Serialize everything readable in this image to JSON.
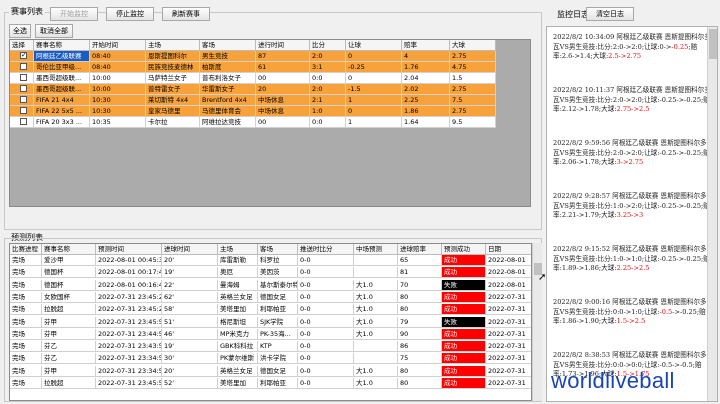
{
  "top_group": {
    "title": "赛事列表"
  },
  "toolbar": {
    "start": "开始监控",
    "stop": "停止监控",
    "refresh": "刷新赛事"
  },
  "select_bar": {
    "select_all": "全选",
    "deselect_all": "取消全部"
  },
  "log_panel": {
    "title": "监控日志",
    "clear": "清空日志"
  },
  "matches": {
    "columns": [
      "选择",
      "赛事名称",
      "开始时间",
      "主场",
      "客场",
      "进行时间",
      "比分",
      "让球",
      "赔率",
      "大球"
    ],
    "rows": [
      {
        "checked": true,
        "style": "orange",
        "sel": true,
        "cells": [
          "阿根廷乙级联赛",
          "08:40",
          "恩斯提图科尔",
          "男生竞技",
          "87",
          "2:0",
          "0",
          "4",
          "2.75"
        ]
      },
      {
        "checked": false,
        "style": "orange",
        "sel": false,
        "cells": [
          "哥伦比亚甲级...",
          "08:40",
          "民族竞技麦德林",
          "柏斯度",
          "61",
          "3:1",
          "-0.25",
          "1.76",
          "4.75"
        ]
      },
      {
        "checked": false,
        "style": "white",
        "sel": false,
        "cells": [
          "墨西哥超级联...",
          "10:00",
          "马萨特兰女子",
          "普布利洛女子",
          "00",
          "0:0",
          "0",
          "2.04",
          "1.5"
        ]
      },
      {
        "checked": false,
        "style": "orange",
        "sel": false,
        "cells": [
          "墨西哥超级联...",
          "10:00",
          "普特雷女子",
          "华雷斯女子",
          "20",
          "2:0",
          "-1.5",
          "2.02",
          "2.75"
        ]
      },
      {
        "checked": false,
        "style": "orange",
        "sel": false,
        "cells": [
          "FIFA 21 4x4",
          "10:30",
          "莱切斯特 4x4",
          "Brentford 4x4",
          "中场休息",
          "2:1",
          "1",
          "2.25",
          "7.5"
        ]
      },
      {
        "checked": false,
        "style": "orange",
        "sel": false,
        "cells": [
          "FIFA 22 5x5 ...",
          "10:30",
          "皇家马德里",
          "马德里体育会",
          "中场休息",
          "1:0",
          "0",
          "1.86",
          "2.75"
        ]
      },
      {
        "checked": false,
        "style": "white",
        "sel": false,
        "cells": [
          "FIFA 20 3x3 ...",
          "10:35",
          "卡尔拉",
          "阿维拉达竞技",
          "00",
          "0:0",
          "1",
          "1.64",
          "9.5"
        ]
      }
    ]
  },
  "pred_group": {
    "title": "预测列表"
  },
  "predictions": {
    "columns": [
      "比赛进程",
      "赛事名称",
      "预测时间",
      "进球时间",
      "主场",
      "客场",
      "推送时比分",
      "中场预测",
      "进球赔率",
      "预测成功",
      "日期"
    ],
    "rows": [
      {
        "c": [
          "完场",
          "爱沙甲",
          "2022-08-01 00:45:31",
          "20'",
          "库雷斯勒",
          "科罗拉",
          "0-0",
          "",
          "65",
          "成功",
          "2022-08-01"
        ],
        "r": "red"
      },
      {
        "c": [
          "完场",
          "德国杯",
          "2022-08-01 00:17:46",
          "19'",
          "奥厄",
          "美因茨",
          "0-0",
          "",
          "81",
          "成功",
          "2022-08-01"
        ],
        "r": "red"
      },
      {
        "c": [
          "完场",
          "德国杯",
          "2022-08-01 00:16:46",
          "22'",
          "曼海姆",
          "基尔斯泰尔特",
          "0-0",
          "大1.0",
          "70",
          "失败",
          "2022-08-01"
        ],
        "r": "black"
      },
      {
        "c": [
          "完场",
          "女欧国杯",
          "2022-07-31 23:45:28",
          "62'",
          "英格兰女足",
          "德国女足",
          "0-0",
          "大1.0",
          "80",
          "成功",
          "2022-07-31"
        ],
        "r": "red"
      },
      {
        "c": [
          "完场",
          "拉脱超",
          "2022-07-31 23:45:28",
          "58'",
          "美塔里加",
          "利耶帕亚",
          "0-0",
          "大1.0",
          "80",
          "成功",
          "2022-07-31"
        ],
        "r": "red"
      },
      {
        "c": [
          "完场",
          "芬甲",
          "2022-07-31 23:45:58",
          "51'",
          "格尼斯坦",
          "SJK学院",
          "0-0",
          "大1.0",
          "79",
          "失败",
          "2022-07-31"
        ],
        "r": "black"
      },
      {
        "c": [
          "完场",
          "芬甲",
          "2022-07-31 23:44:59",
          "46'",
          "MP米克力",
          "PK-35海...",
          "0-0",
          "大1.0",
          "90",
          "成功",
          "2022-07-31"
        ],
        "r": "red"
      },
      {
        "c": [
          "完场",
          "芬乙",
          "2022-07-31 23:43:58",
          "19'",
          "GBK科科拉",
          "KTP",
          "0-0",
          "",
          "86",
          "成功",
          "2022-07-31"
        ],
        "r": "red"
      },
      {
        "c": [
          "完场",
          "芬乙",
          "2022-07-31 23:34:57",
          "30'",
          "PK蒙尔维斯",
          "洪卡学院",
          "0-0",
          "",
          "75",
          "成功",
          "2022-07-31"
        ],
        "r": "red"
      },
      {
        "c": [
          "完场",
          "芬甲",
          "2022-07-31 23:34:57",
          "20'",
          "英格兰女足",
          "德国女足",
          "0-0",
          "大1.0",
          "80",
          "成功",
          "2022-07-31"
        ],
        "r": "red"
      },
      {
        "c": [
          "完场",
          "拉脱超",
          "2022-07-31 23:45:58",
          "52'",
          "美塔里加",
          "利耶帕亚",
          "0-0",
          "大1.0",
          "80",
          "成功",
          "2022-07-31"
        ],
        "r": "red"
      }
    ]
  },
  "log_entries": [
    {
      "pre": "2022/8/2 10:34:09 阿根廷乙级联赛 恩斯提图科尔多瓦VS男生竞技:比分:2:0->2:0;让球:0->-",
      "hl1": "0.25",
      "mid": ";赔率:2.6->1.4;大球:",
      "hl2": "2.5->2.75"
    },
    {
      "pre": "2022/8/2 10:11:37 阿根廷乙级联赛 恩斯提图科尔多瓦VS男生竞技:比分:2:0->2:0;让球:-0.25->-0.25;赔率:2.12->1.78;大球:",
      "hl1": "",
      "mid": "",
      "hl2": "2.75->2.5"
    },
    {
      "pre": "2022/8/2 9:59:56 阿根廷乙级联赛 恩斯提图科尔多瓦VS男生竞技:比分:2:0->2:0;让球:-0.25->-0.25;赔率:2.06->1.78;大球:",
      "hl1": "",
      "mid": "",
      "hl2": "3->2.75"
    },
    {
      "pre": "2022/8/2 9:28:57 阿根廷乙级联赛 恩斯提图科尔多瓦VS男生竞技:比分:1:0->2:0;让球:-0.25->-0.25;赔率:2.21->1.79;大球:",
      "hl1": "",
      "mid": "",
      "hl2": "3.25->3"
    },
    {
      "pre": "2022/8/2 9:15:52 阿根廷乙级联赛 恩斯提图科尔多瓦VS男生竞技:比分:1:0->1:0;让球:-0.25->-0.25;赔率:1.89->1.86;大球:",
      "hl1": "",
      "mid": "",
      "hl2": "2.25->2.5"
    },
    {
      "pre": "2022/8/2 9:00:16 阿根廷乙级联赛 恩斯提图科尔多瓦VS男生竞技:比分:0:0->1:0;让球:-",
      "hl1": "0.5",
      "mid": "->-0.25;赔率:1.86->1.90;大球:",
      "hl2": "1.5->2.5"
    },
    {
      "pre": "2022/8/2 8:38:53 阿根廷乙级联赛 恩斯提图科尔多瓦VS男生竞技:比分:0:0->0:0;让球:-0.5->-0.5;赔率:1.73->1.96;大球:",
      "hl1": "",
      "mid": "",
      "hl2": "1.5->1.75"
    }
  ],
  "watermark": "worldliveball"
}
